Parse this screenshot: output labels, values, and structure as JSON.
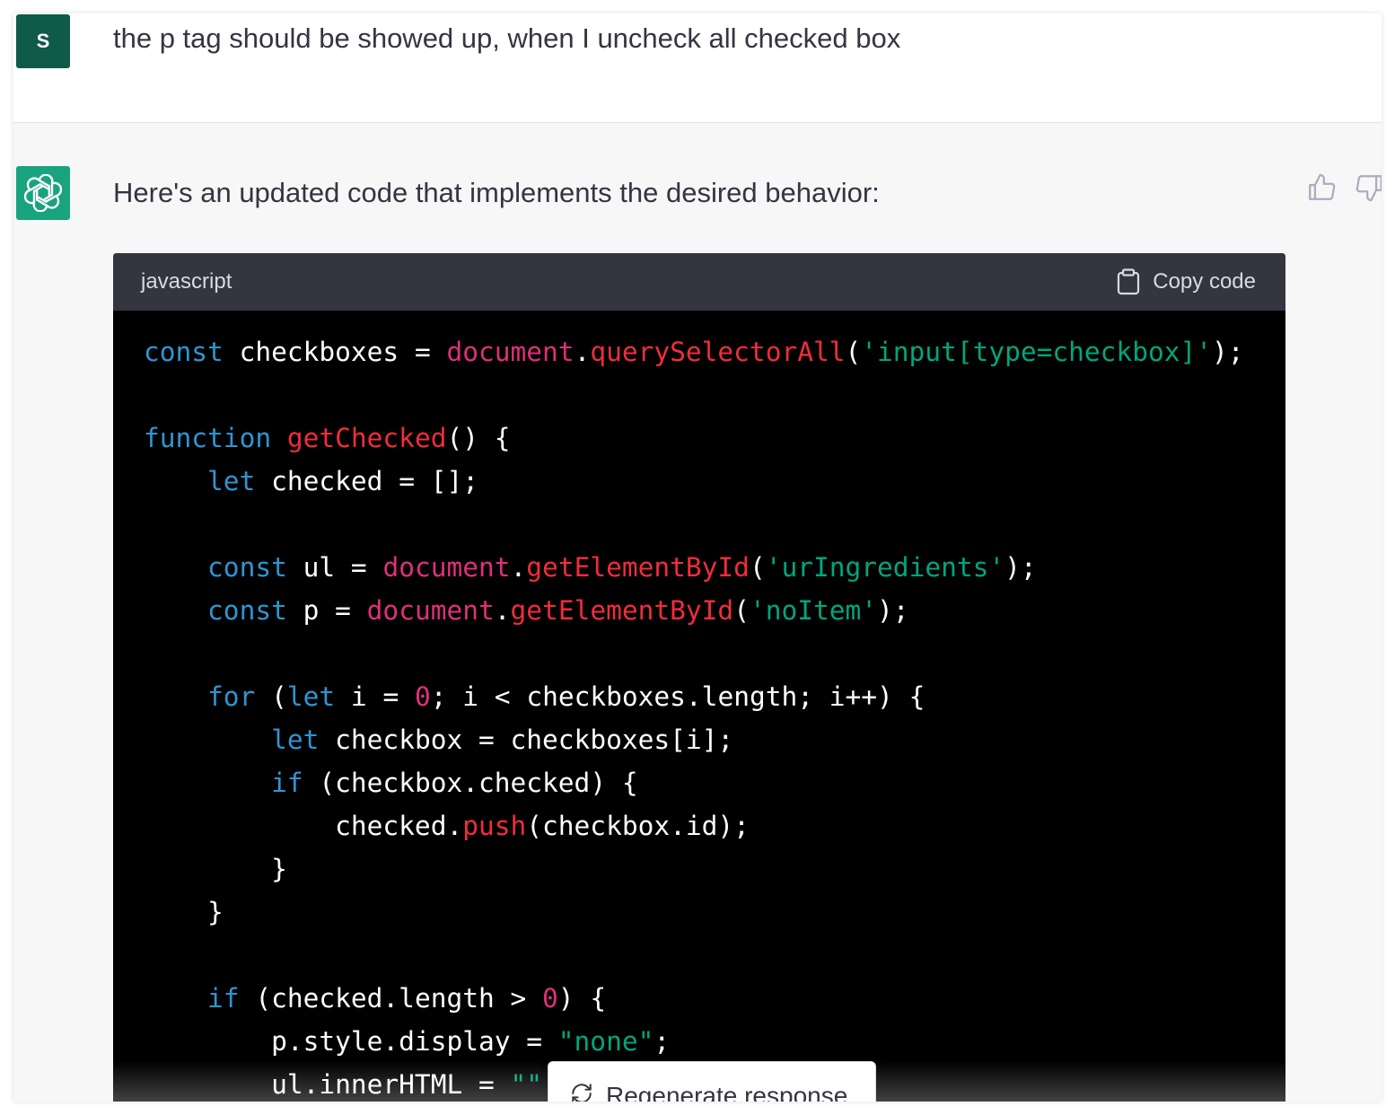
{
  "user_message": {
    "avatar_letter": "S",
    "text": "the p tag should be showed up, when I uncheck all checked box"
  },
  "assistant_message": {
    "text": "Here's an updated code that implements the desired behavior:",
    "code_block": {
      "language": "javascript",
      "copy_label": "Copy code"
    }
  },
  "feedback": {
    "thumbs_up_icon": "thumbs-up-icon",
    "thumbs_down_icon": "thumbs-down-icon"
  },
  "regenerate_label": "Regenerate response",
  "colors": {
    "user_avatar": "#0f5a48",
    "assistant_avatar": "#19a37f",
    "keyword": "#2e95d3",
    "function": "#f22c3d",
    "string": "#00a67d",
    "builtin": "#df3079"
  }
}
